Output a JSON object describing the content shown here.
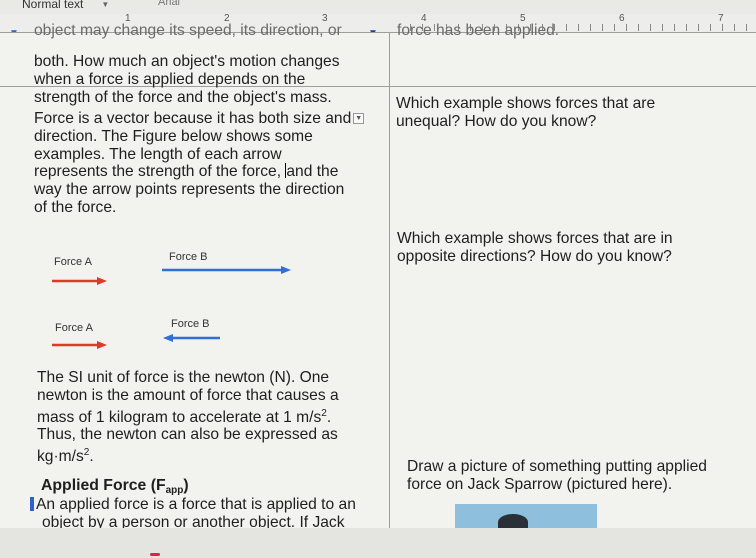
{
  "toolbar": {
    "paragraph_style": "Normal text",
    "font": "Arial"
  },
  "ruler": {
    "numbers": [
      "1",
      "2",
      "3",
      "4",
      "5",
      "6",
      "7"
    ]
  },
  "left_column": {
    "intro_partial": "object may change its speed, its direction, or",
    "intro_lines": [
      "both. How much an object's motion changes",
      "when a force is applied depends on the",
      "strength of the force and the object's mass."
    ],
    "vector_lines": [
      "Force is a vector because it has both size and",
      "direction. The Figure below shows some",
      "examples. The length of each arrow",
      "represents the strength of the force, ",
      "and the",
      "way the arrow points represents the direction",
      "of the force."
    ],
    "figure": {
      "row1_a": "Force A",
      "row1_b": "Force B",
      "row2_a": "Force A",
      "row2_b": "Force B",
      "colors": {
        "red": "#d93a2b",
        "blue": "#2f6fd6"
      }
    },
    "si_lines": [
      "The SI unit of force is the newton (N). One",
      "newton is the amount of force that causes a",
      "mass of 1 kilogram to accelerate at 1 m/s",
      "2",
      ".",
      "Thus, the newton can also be expressed as",
      "kg·m/s",
      "2",
      "."
    ],
    "applied_heading": "Applied Force (F",
    "applied_sub": "app",
    "applied_close": ")",
    "applied_lines": [
      "An applied force is a force that is applied to an",
      "object by a person or another object. If Jack"
    ]
  },
  "right_column": {
    "partial_top": "force has been applied.",
    "q1": [
      "Which example shows forces that are",
      "unequal?  How do you know?"
    ],
    "q2": [
      "Which example shows forces that are in",
      "opposite directions?  How do you know?"
    ],
    "q3": [
      "Draw a picture of something putting applied",
      "force on Jack Sparrow (pictured here)."
    ]
  }
}
